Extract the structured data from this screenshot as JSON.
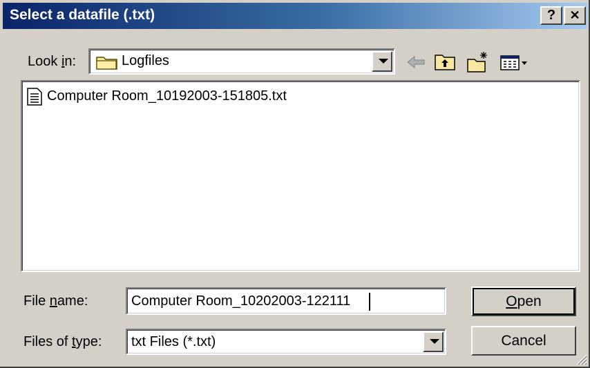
{
  "window": {
    "title": "Select a datafile (.txt)",
    "help_glyph": "?",
    "close_glyph": "✕"
  },
  "look_in": {
    "label_pre": "Look ",
    "label_key": "i",
    "label_post": "n:",
    "value": "Logfiles"
  },
  "files": [
    {
      "name": "Computer Room_10192003-151805.txt"
    }
  ],
  "file_name": {
    "label_pre": "File ",
    "label_key": "n",
    "label_post": "ame:",
    "value": "Computer Room_10202003-122111"
  },
  "file_type": {
    "label_pre": "Files of ",
    "label_key": "t",
    "label_post": "ype:",
    "value": "txt Files (*.txt)"
  },
  "buttons": {
    "open_key": "O",
    "open_rest": "pen",
    "cancel": "Cancel"
  },
  "icons": [
    "folder-icon",
    "back-arrow-icon",
    "up-folder-icon",
    "new-folder-icon",
    "view-menu-icon",
    "text-file-icon"
  ]
}
